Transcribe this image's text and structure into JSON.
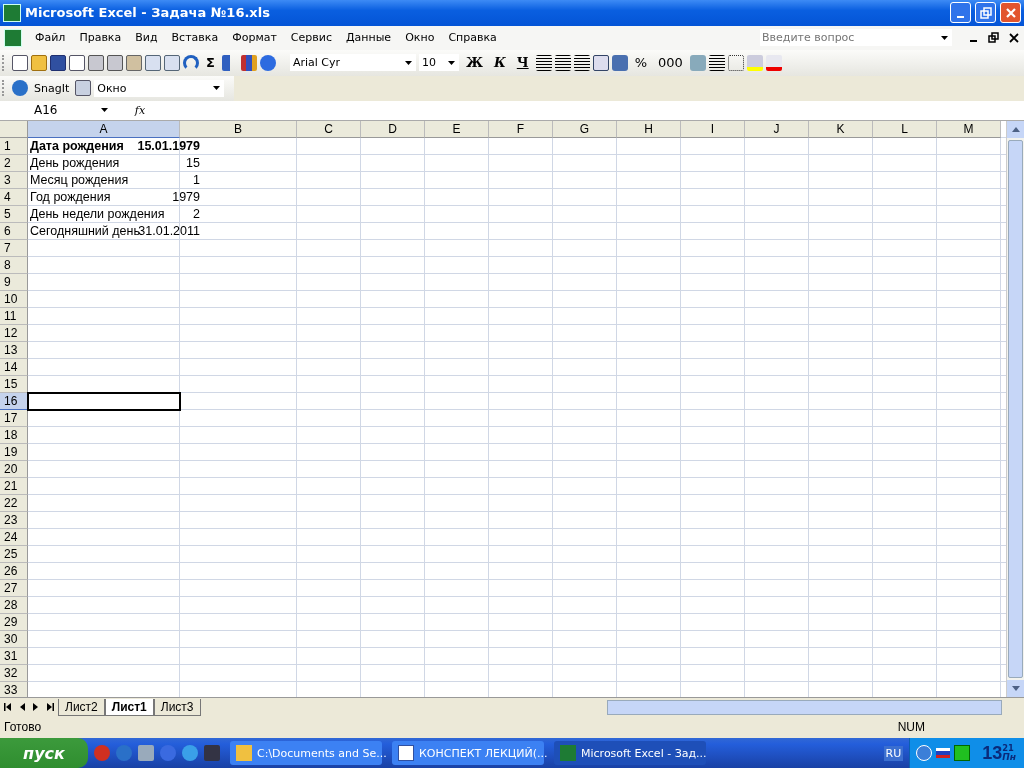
{
  "window": {
    "title": "Microsoft Excel - Задача №16.xls"
  },
  "menu": [
    "Файл",
    "Правка",
    "Вид",
    "Вставка",
    "Формат",
    "Сервис",
    "Данные",
    "Окно",
    "Справка"
  ],
  "help_search": {
    "placeholder": "Введите вопрос"
  },
  "toolbar": {
    "sum": "Σ",
    "font": "Arial Cyr",
    "size": "10",
    "bold": "Ж",
    "italic": "К",
    "underline": "Ч",
    "percent": "%",
    "thousands": "000"
  },
  "snagit": {
    "label": "SnagIt",
    "target": "Окно"
  },
  "formula_bar": {
    "name_box": "A16",
    "fx": "fx"
  },
  "columns": [
    {
      "label": "A",
      "selected": true
    },
    {
      "label": "B",
      "selected": false
    },
    {
      "label": "C",
      "selected": false
    },
    {
      "label": "D",
      "selected": false
    },
    {
      "label": "E",
      "selected": false
    },
    {
      "label": "F",
      "selected": false
    },
    {
      "label": "G",
      "selected": false
    },
    {
      "label": "H",
      "selected": false
    },
    {
      "label": "I",
      "selected": false
    },
    {
      "label": "J",
      "selected": false
    },
    {
      "label": "K",
      "selected": false
    },
    {
      "label": "L",
      "selected": false
    },
    {
      "label": "M",
      "selected": false
    }
  ],
  "rows": [
    {
      "number": "1",
      "selected": false,
      "bold": true,
      "cells": [
        "Дата рождения",
        "15.01.1979"
      ]
    },
    {
      "number": "2",
      "selected": false,
      "bold": false,
      "cells": [
        "День рождения",
        "15"
      ]
    },
    {
      "number": "3",
      "selected": false,
      "bold": false,
      "cells": [
        "Месяц рождения",
        "1"
      ]
    },
    {
      "number": "4",
      "selected": false,
      "bold": false,
      "cells": [
        "Год рождения",
        "1979"
      ]
    },
    {
      "number": "5",
      "selected": false,
      "bold": false,
      "cells": [
        "День недели рождения",
        "2"
      ]
    },
    {
      "number": "6",
      "selected": false,
      "bold": false,
      "cells": [
        "Сегодняшний день",
        "31.01.2011"
      ]
    },
    {
      "number": "7",
      "selected": false
    },
    {
      "number": "8",
      "selected": false
    },
    {
      "number": "9",
      "selected": false
    },
    {
      "number": "10",
      "selected": false
    },
    {
      "number": "11",
      "selected": false
    },
    {
      "number": "12",
      "selected": false
    },
    {
      "number": "13",
      "selected": false
    },
    {
      "number": "14",
      "selected": false
    },
    {
      "number": "15",
      "selected": false
    },
    {
      "number": "16",
      "selected": true
    },
    {
      "number": "17",
      "selected": false
    },
    {
      "number": "18",
      "selected": false
    },
    {
      "number": "19",
      "selected": false
    },
    {
      "number": "20",
      "selected": false
    },
    {
      "number": "21",
      "selected": false
    },
    {
      "number": "22",
      "selected": false
    },
    {
      "number": "23",
      "selected": false
    },
    {
      "number": "24",
      "selected": false
    },
    {
      "number": "25",
      "selected": false
    },
    {
      "number": "26",
      "selected": false
    },
    {
      "number": "27",
      "selected": false
    },
    {
      "number": "28",
      "selected": false
    },
    {
      "number": "29",
      "selected": false
    },
    {
      "number": "30",
      "selected": false
    },
    {
      "number": "31",
      "selected": false
    },
    {
      "number": "32",
      "selected": false
    },
    {
      "number": "33",
      "selected": false
    }
  ],
  "sheet_tabs": [
    {
      "label": "Лист2",
      "selected": false
    },
    {
      "label": "Лист1",
      "selected": true
    },
    {
      "label": "Лист3",
      "selected": false
    }
  ],
  "status_bar": {
    "text": "Готово",
    "num": "NUM"
  },
  "taskbar": {
    "start": "пуск",
    "tasks": [
      {
        "label": "C:\\Documents and Se...",
        "kind": "folder",
        "selected": false
      },
      {
        "label": "КОНСПЕКТ ЛЕКЦИЙ(...",
        "kind": "word",
        "selected": false
      },
      {
        "label": "Microsoft Excel - Зад...",
        "kind": "excel",
        "selected": true
      }
    ],
    "language": "RU",
    "clock": {
      "hours": "13",
      "minutes": "21",
      "day": "Пн"
    }
  }
}
